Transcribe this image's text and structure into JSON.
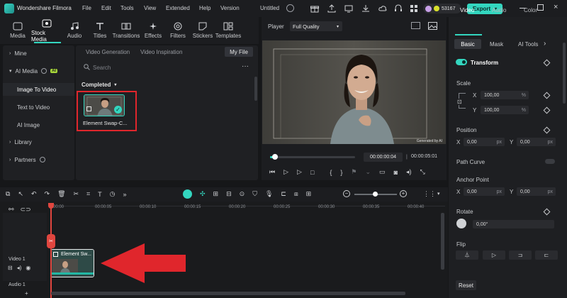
{
  "titlebar": {
    "app_title": "Wondershare Filmora",
    "menu": [
      "File",
      "Edit",
      "Tools",
      "View",
      "Extended",
      "Help",
      "Version"
    ],
    "project_title": "Untitled",
    "credits": "53167",
    "export_label": "Export"
  },
  "media_toolbar": {
    "tabs": [
      "Media",
      "Stock Media",
      "Audio",
      "Titles",
      "Transitions",
      "Effects",
      "Filters",
      "Stickers",
      "Templates"
    ]
  },
  "library": {
    "items": [
      {
        "label": "Mine"
      },
      {
        "label": "AI Media",
        "badge": "AI"
      },
      {
        "label": "Image To Video"
      },
      {
        "label": "Text to Video"
      },
      {
        "label": "AI Image"
      },
      {
        "label": "Library"
      },
      {
        "label": "Partners"
      }
    ]
  },
  "content": {
    "subtabs": [
      "Video Generation",
      "Video Inspiration"
    ],
    "my_file": "My File",
    "search_placeholder": "Search",
    "completed_label": "Completed",
    "media_item_label": "Element Swap-C..."
  },
  "player": {
    "label": "Player",
    "quality": "Full Quality",
    "watermark": "Generated by AI",
    "current_time": "00:00:00:04",
    "total_time": "00:00:05:01",
    "progress": 0.03
  },
  "properties": {
    "tabs": [
      "Video",
      "Audio",
      "Color"
    ],
    "subtabs": [
      "Basic",
      "Mask",
      "AI Tools"
    ],
    "transform_label": "Transform",
    "scale_label": "Scale",
    "scale_x": "100,00",
    "scale_y": "100,00",
    "scale_unit": "%",
    "position_label": "Position",
    "pos_x": "0,00",
    "pos_y": "0,00",
    "pos_unit": "px",
    "path_curve_label": "Path Curve",
    "anchor_label": "Anchor Point",
    "anchor_x": "0,00",
    "anchor_y": "0,00",
    "rotate_label": "Rotate",
    "rotate_value": "0,00°",
    "flip_label": "Flip",
    "reset_label": "Reset",
    "axis_x": "X",
    "axis_y": "Y"
  },
  "timeline": {
    "ticks": [
      "00:00",
      "00:00:05",
      "00:00:10",
      "00:00:15",
      "00:00:20",
      "00:00:25",
      "00:00:30",
      "00:00:35",
      "00:00:40"
    ],
    "video_track_label": "Video 1",
    "audio_track_label": "Audio 1",
    "clip_label": "Element Sw..."
  },
  "colors": {
    "accent": "#33d6bf",
    "highlight_box": "#e0262c",
    "arrow": "#e0262c",
    "playhead": "#e0463f"
  }
}
